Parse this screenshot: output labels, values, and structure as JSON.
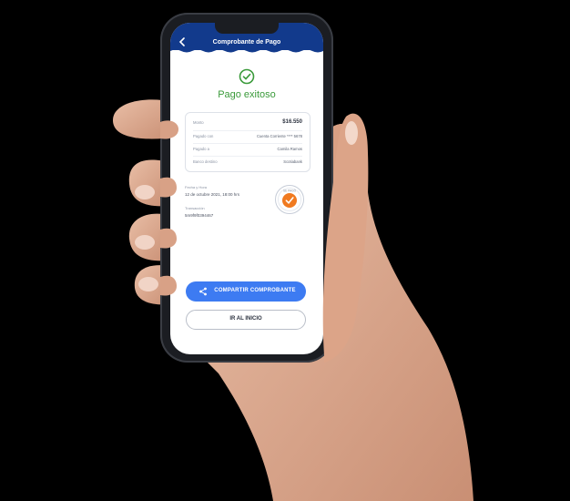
{
  "header": {
    "title": "Comprobante de Pago"
  },
  "status": {
    "title": "Pago exitoso"
  },
  "summary": {
    "rows": [
      {
        "label": "Monto",
        "value": "$16.550"
      },
      {
        "label": "Pagado con",
        "value": "Cuenta Corriente **** 5678"
      },
      {
        "label": "Pagado a",
        "value": "Camila Ramos"
      },
      {
        "label": "Banco destino",
        "value": "Scotiabank"
      }
    ]
  },
  "details": {
    "date_label": "Fecha y Hora",
    "date_value": "12 de octubre 2021, 18:00 hrs",
    "transaction_label": "Transacción",
    "transaction_value": "5m9f9f0394467"
  },
  "badge": {
    "text": "SE PAGÓ"
  },
  "actions": {
    "share_label": "COMPARTIR COMPROBANTE",
    "home_label": "IR AL INICIO"
  },
  "colors": {
    "header": "#123a8c",
    "success": "#3a9a3a",
    "primary": "#3d7bf2",
    "badge": "#f07a20"
  },
  "icons": [
    "back-arrow-icon",
    "check-circle-icon",
    "share-icon",
    "paid-stamp-icon"
  ]
}
